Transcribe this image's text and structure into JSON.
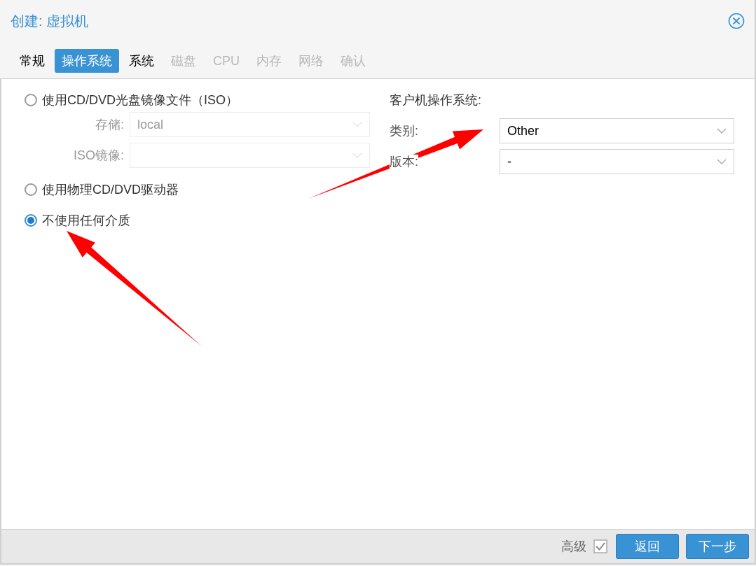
{
  "window": {
    "title": "创建: 虚拟机"
  },
  "tabs": [
    {
      "label": "常规",
      "selected": false,
      "disabled": false
    },
    {
      "label": "操作系统",
      "selected": true,
      "disabled": false
    },
    {
      "label": "系统",
      "selected": false,
      "disabled": false
    },
    {
      "label": "磁盘",
      "selected": false,
      "disabled": true
    },
    {
      "label": "CPU",
      "selected": false,
      "disabled": true
    },
    {
      "label": "内存",
      "selected": false,
      "disabled": true
    },
    {
      "label": "网络",
      "selected": false,
      "disabled": true
    },
    {
      "label": "确认",
      "selected": false,
      "disabled": true
    }
  ],
  "media": {
    "options": [
      {
        "label": "使用CD/DVD光盘镜像文件（ISO）",
        "selected": false,
        "fields": [
          {
            "label": "存储:",
            "value": "local",
            "disabled": true
          },
          {
            "label": "ISO镜像:",
            "disabled": true
          }
        ]
      },
      {
        "label": "使用物理CD/DVD驱动器",
        "selected": false
      },
      {
        "label": "不使用任何介质",
        "selected": true
      }
    ]
  },
  "guest_os": {
    "heading": "客户机操作系统:",
    "fields": [
      {
        "label": "类别:",
        "value": "Other",
        "disabled": false
      },
      {
        "label": "版本:",
        "value": "-",
        "disabled": false
      }
    ]
  },
  "footer": {
    "advanced": {
      "label": "高级",
      "checked": true
    },
    "buttons": [
      "返回",
      "下一步"
    ]
  }
}
